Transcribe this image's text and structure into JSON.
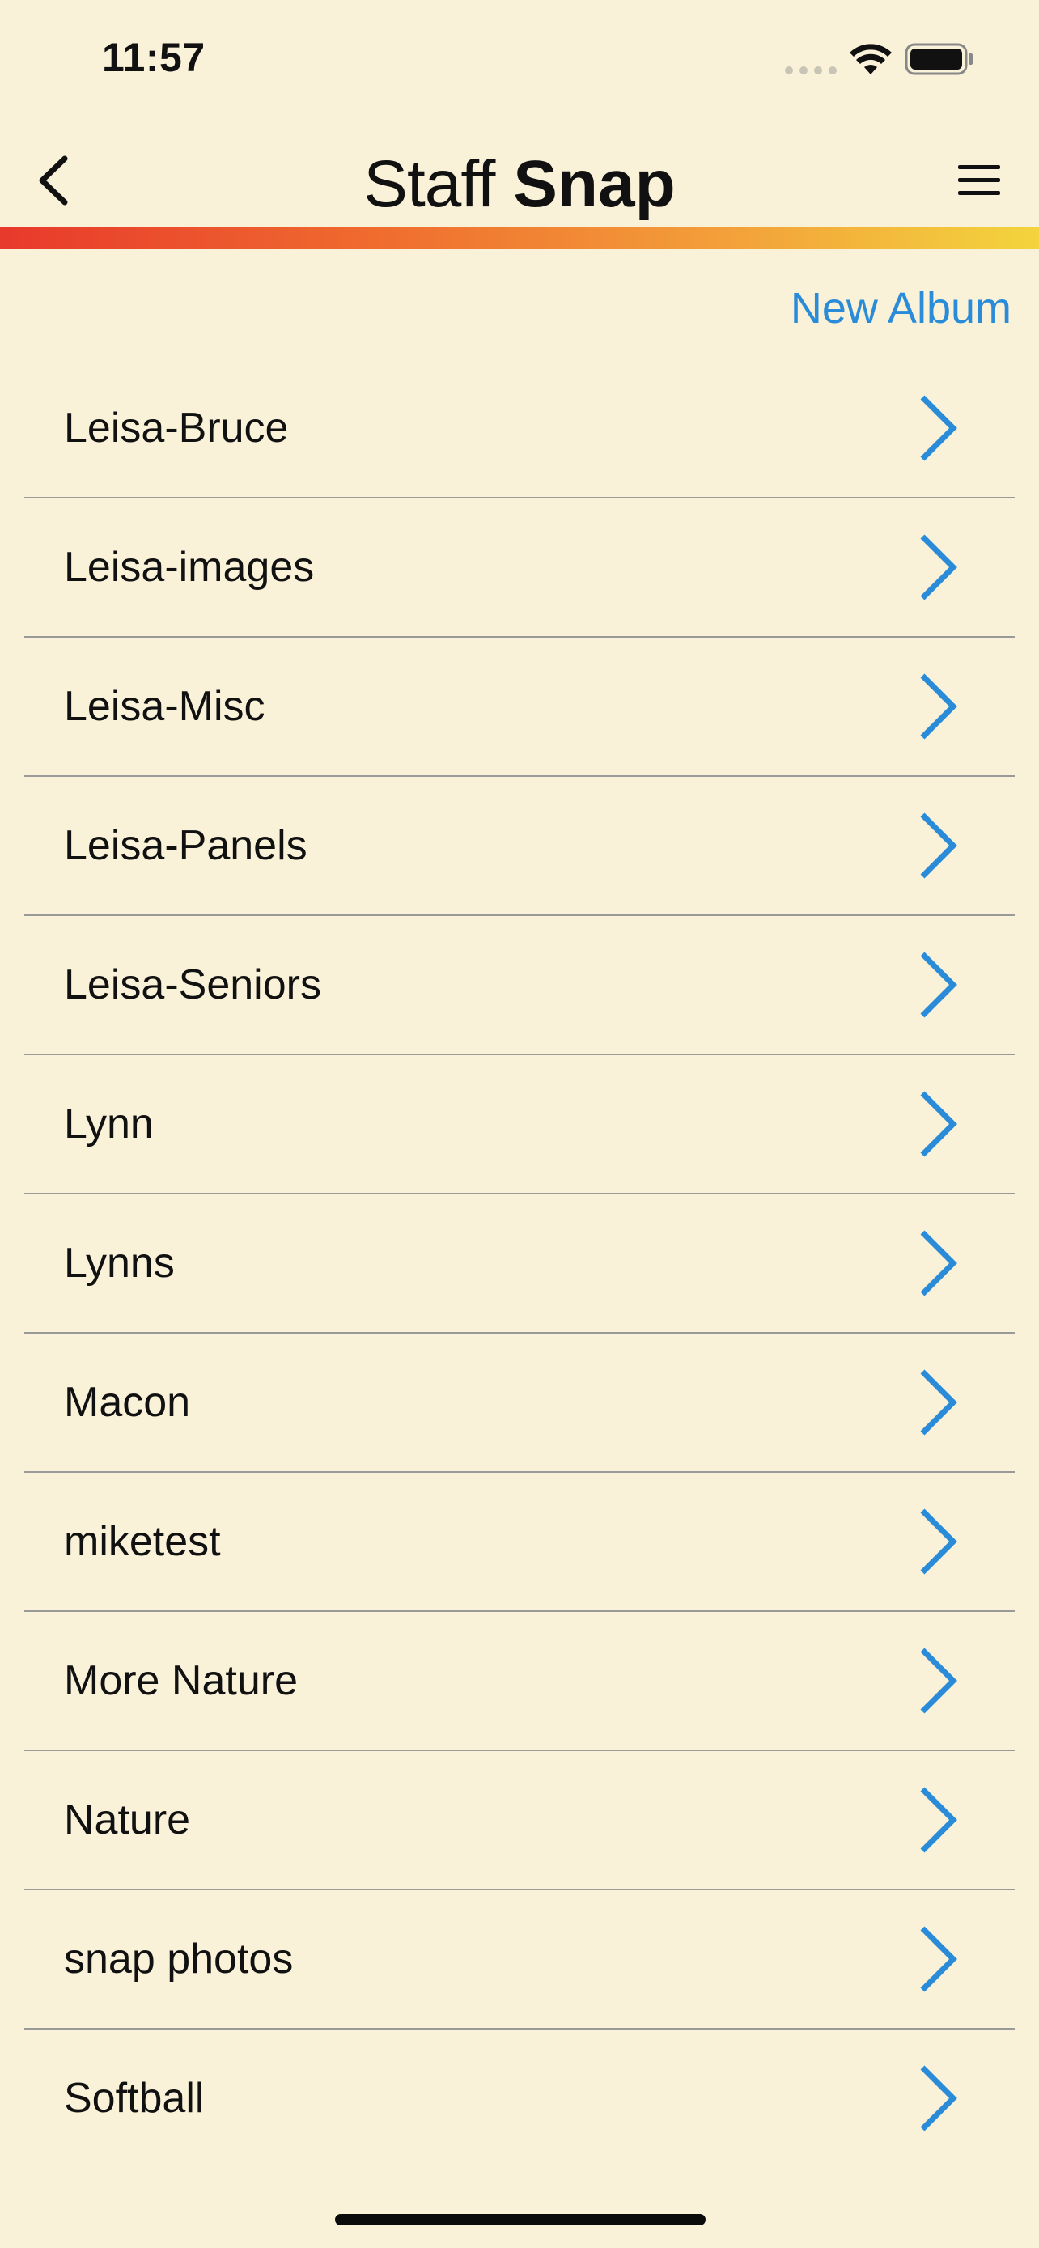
{
  "status_bar": {
    "time": "11:57",
    "icons": [
      "signal-dots-icon",
      "wifi-icon",
      "battery-icon"
    ]
  },
  "nav": {
    "title_light": "Staff",
    "title_bold": "Snap",
    "back_icon": "chevron-left-icon",
    "menu_icon": "hamburger-menu-icon"
  },
  "colors": {
    "background": "#f9f2d9",
    "accent": "#2a8cd8",
    "gradient_start": "#e8392c",
    "gradient_end": "#f3d43d"
  },
  "actions": {
    "new_album_label": "New Album"
  },
  "albums": [
    {
      "label": "Leisa-Bruce"
    },
    {
      "label": "Leisa-images"
    },
    {
      "label": "Leisa-Misc"
    },
    {
      "label": "Leisa-Panels"
    },
    {
      "label": "Leisa-Seniors"
    },
    {
      "label": "Lynn"
    },
    {
      "label": "Lynns"
    },
    {
      "label": "Macon"
    },
    {
      "label": "miketest"
    },
    {
      "label": "More Nature"
    },
    {
      "label": "Nature"
    },
    {
      "label": "snap photos"
    },
    {
      "label": "Softball"
    }
  ]
}
